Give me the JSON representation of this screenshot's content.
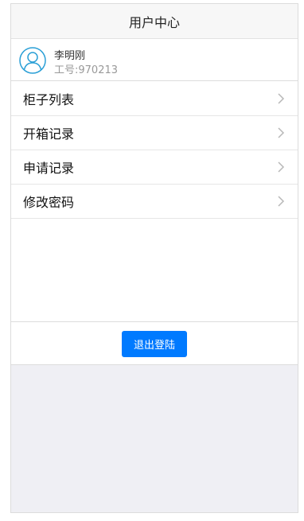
{
  "header": {
    "title": "用户中心"
  },
  "user": {
    "name": "李明刚",
    "employee_id": "工号:970213"
  },
  "menu": {
    "items": [
      {
        "label": "柜子列表"
      },
      {
        "label": "开箱记录"
      },
      {
        "label": "申请记录"
      },
      {
        "label": "修改密码"
      }
    ]
  },
  "logout": {
    "label": "退出登陆"
  },
  "colors": {
    "primary": "#007aff",
    "avatar": "#2a9fd6",
    "background": "#efeff4"
  },
  "icons": {
    "avatar": "user-avatar-icon",
    "chevron": "chevron-right-icon"
  }
}
